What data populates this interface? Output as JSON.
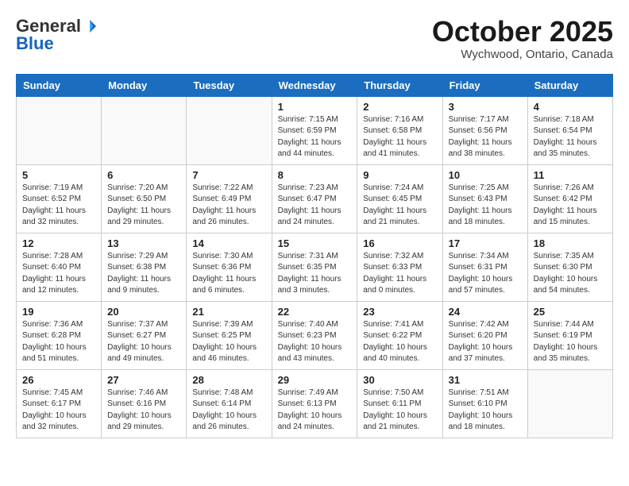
{
  "header": {
    "logo_general": "General",
    "logo_blue": "Blue",
    "month": "October 2025",
    "location": "Wychwood, Ontario, Canada"
  },
  "weekdays": [
    "Sunday",
    "Monday",
    "Tuesday",
    "Wednesday",
    "Thursday",
    "Friday",
    "Saturday"
  ],
  "weeks": [
    [
      {
        "day": "",
        "info": ""
      },
      {
        "day": "",
        "info": ""
      },
      {
        "day": "",
        "info": ""
      },
      {
        "day": "1",
        "info": "Sunrise: 7:15 AM\nSunset: 6:59 PM\nDaylight: 11 hours and 44 minutes."
      },
      {
        "day": "2",
        "info": "Sunrise: 7:16 AM\nSunset: 6:58 PM\nDaylight: 11 hours and 41 minutes."
      },
      {
        "day": "3",
        "info": "Sunrise: 7:17 AM\nSunset: 6:56 PM\nDaylight: 11 hours and 38 minutes."
      },
      {
        "day": "4",
        "info": "Sunrise: 7:18 AM\nSunset: 6:54 PM\nDaylight: 11 hours and 35 minutes."
      }
    ],
    [
      {
        "day": "5",
        "info": "Sunrise: 7:19 AM\nSunset: 6:52 PM\nDaylight: 11 hours and 32 minutes."
      },
      {
        "day": "6",
        "info": "Sunrise: 7:20 AM\nSunset: 6:50 PM\nDaylight: 11 hours and 29 minutes."
      },
      {
        "day": "7",
        "info": "Sunrise: 7:22 AM\nSunset: 6:49 PM\nDaylight: 11 hours and 26 minutes."
      },
      {
        "day": "8",
        "info": "Sunrise: 7:23 AM\nSunset: 6:47 PM\nDaylight: 11 hours and 24 minutes."
      },
      {
        "day": "9",
        "info": "Sunrise: 7:24 AM\nSunset: 6:45 PM\nDaylight: 11 hours and 21 minutes."
      },
      {
        "day": "10",
        "info": "Sunrise: 7:25 AM\nSunset: 6:43 PM\nDaylight: 11 hours and 18 minutes."
      },
      {
        "day": "11",
        "info": "Sunrise: 7:26 AM\nSunset: 6:42 PM\nDaylight: 11 hours and 15 minutes."
      }
    ],
    [
      {
        "day": "12",
        "info": "Sunrise: 7:28 AM\nSunset: 6:40 PM\nDaylight: 11 hours and 12 minutes."
      },
      {
        "day": "13",
        "info": "Sunrise: 7:29 AM\nSunset: 6:38 PM\nDaylight: 11 hours and 9 minutes."
      },
      {
        "day": "14",
        "info": "Sunrise: 7:30 AM\nSunset: 6:36 PM\nDaylight: 11 hours and 6 minutes."
      },
      {
        "day": "15",
        "info": "Sunrise: 7:31 AM\nSunset: 6:35 PM\nDaylight: 11 hours and 3 minutes."
      },
      {
        "day": "16",
        "info": "Sunrise: 7:32 AM\nSunset: 6:33 PM\nDaylight: 11 hours and 0 minutes."
      },
      {
        "day": "17",
        "info": "Sunrise: 7:34 AM\nSunset: 6:31 PM\nDaylight: 10 hours and 57 minutes."
      },
      {
        "day": "18",
        "info": "Sunrise: 7:35 AM\nSunset: 6:30 PM\nDaylight: 10 hours and 54 minutes."
      }
    ],
    [
      {
        "day": "19",
        "info": "Sunrise: 7:36 AM\nSunset: 6:28 PM\nDaylight: 10 hours and 51 minutes."
      },
      {
        "day": "20",
        "info": "Sunrise: 7:37 AM\nSunset: 6:27 PM\nDaylight: 10 hours and 49 minutes."
      },
      {
        "day": "21",
        "info": "Sunrise: 7:39 AM\nSunset: 6:25 PM\nDaylight: 10 hours and 46 minutes."
      },
      {
        "day": "22",
        "info": "Sunrise: 7:40 AM\nSunset: 6:23 PM\nDaylight: 10 hours and 43 minutes."
      },
      {
        "day": "23",
        "info": "Sunrise: 7:41 AM\nSunset: 6:22 PM\nDaylight: 10 hours and 40 minutes."
      },
      {
        "day": "24",
        "info": "Sunrise: 7:42 AM\nSunset: 6:20 PM\nDaylight: 10 hours and 37 minutes."
      },
      {
        "day": "25",
        "info": "Sunrise: 7:44 AM\nSunset: 6:19 PM\nDaylight: 10 hours and 35 minutes."
      }
    ],
    [
      {
        "day": "26",
        "info": "Sunrise: 7:45 AM\nSunset: 6:17 PM\nDaylight: 10 hours and 32 minutes."
      },
      {
        "day": "27",
        "info": "Sunrise: 7:46 AM\nSunset: 6:16 PM\nDaylight: 10 hours and 29 minutes."
      },
      {
        "day": "28",
        "info": "Sunrise: 7:48 AM\nSunset: 6:14 PM\nDaylight: 10 hours and 26 minutes."
      },
      {
        "day": "29",
        "info": "Sunrise: 7:49 AM\nSunset: 6:13 PM\nDaylight: 10 hours and 24 minutes."
      },
      {
        "day": "30",
        "info": "Sunrise: 7:50 AM\nSunset: 6:11 PM\nDaylight: 10 hours and 21 minutes."
      },
      {
        "day": "31",
        "info": "Sunrise: 7:51 AM\nSunset: 6:10 PM\nDaylight: 10 hours and 18 minutes."
      },
      {
        "day": "",
        "info": ""
      }
    ]
  ]
}
